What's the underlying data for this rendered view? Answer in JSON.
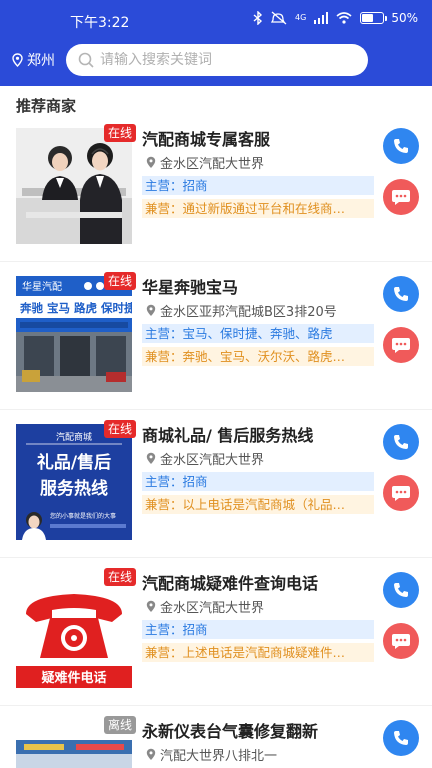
{
  "status_bar": {
    "time": "下午3:22",
    "battery": "50%",
    "battery_level": 0.5,
    "network": "4G"
  },
  "header": {
    "city": "郑州",
    "search_placeholder": "请输入搜索关键词"
  },
  "section_title": "推荐商家",
  "merchants": [
    {
      "status": "在线",
      "name": "汽配商城专属客服",
      "address": "金水区汽配大世界",
      "main_business": "主营：招商",
      "side_business": "兼营：通过新版通过平台和在线商…"
    },
    {
      "status": "在线",
      "name": "华星奔驰宝马",
      "address": "金水区亚邦汽配城B区3排20号",
      "main_business": "主营：宝马、保时捷、奔驰、路虎",
      "side_business": "兼营：奔驰、宝马、沃尔沃、路虎…",
      "sign_top": "华星汽配",
      "sign_big": "奔驰 宝马 路虎 保时捷"
    },
    {
      "status": "在线",
      "name": "商城礼品/ 售后服务热线",
      "address": "金水区汽配大世界",
      "main_business": "主营：招商",
      "side_business": "兼营：以上电话是汽配商城（礼品…",
      "poster_top": "汽配商城",
      "poster_line1": "礼品/售后",
      "poster_line2": "服务热线",
      "poster_small": "您的小事就是我们的大事"
    },
    {
      "status": "在线",
      "name": "汽配商城疑难件查询电话",
      "address": "金水区汽配大世界",
      "main_business": "主营：招商",
      "side_business": "兼营：上述电话是汽配商城疑难件…",
      "poster_caption": "疑难件电话"
    },
    {
      "status": "离线",
      "name": "永新仪表台气囊修复翻新",
      "address": "汽配大世界八排北一"
    }
  ],
  "colors": {
    "header": "#2b4bd8",
    "phone": "#2f86f0",
    "message": "#f05a5a",
    "online": "#e52a2a",
    "offline": "#999999"
  }
}
